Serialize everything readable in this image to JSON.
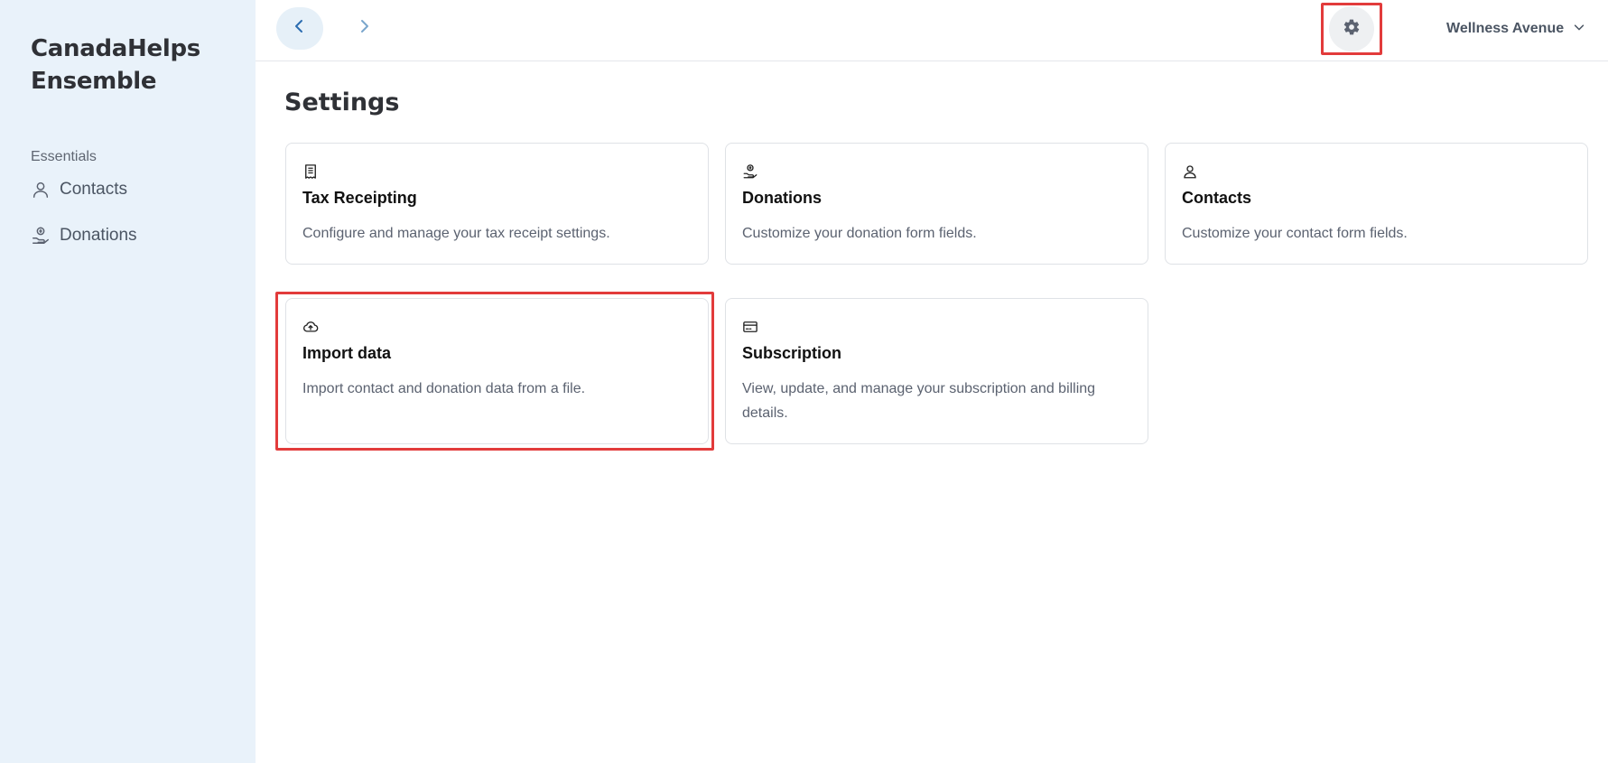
{
  "sidebar": {
    "brand_line1": "CanadaHelps",
    "brand_line2": "Ensemble",
    "section_label": "Essentials",
    "items": [
      {
        "label": "Contacts",
        "icon": "user-icon"
      },
      {
        "label": "Donations",
        "icon": "donation-hand-icon"
      }
    ]
  },
  "header": {
    "back_icon": "chevron-left-icon",
    "forward_icon": "chevron-right-icon",
    "settings_icon": "gear-icon",
    "org_name": "Wellness Avenue",
    "org_dropdown_icon": "chevron-down-icon"
  },
  "page": {
    "title": "Settings"
  },
  "cards": [
    {
      "title": "Tax Receipting",
      "description": "Configure and manage your tax receipt settings.",
      "icon": "receipt-icon"
    },
    {
      "title": "Donations",
      "description": "Customize your donation form fields.",
      "icon": "donation-hand-icon"
    },
    {
      "title": "Contacts",
      "description": "Customize your contact form fields.",
      "icon": "user-icon"
    },
    {
      "title": "Import data",
      "description": "Import contact and donation data from a file.",
      "icon": "cloud-upload-icon"
    },
    {
      "title": "Subscription",
      "description": "View, update, and manage your subscription and billing details.",
      "icon": "credit-card-icon"
    }
  ],
  "colors": {
    "sidebar_bg": "#e9f2fa",
    "highlight": "#e23b3b",
    "back_button_bg": "#e6f0f8",
    "link_blue": "#2b6cb0"
  }
}
